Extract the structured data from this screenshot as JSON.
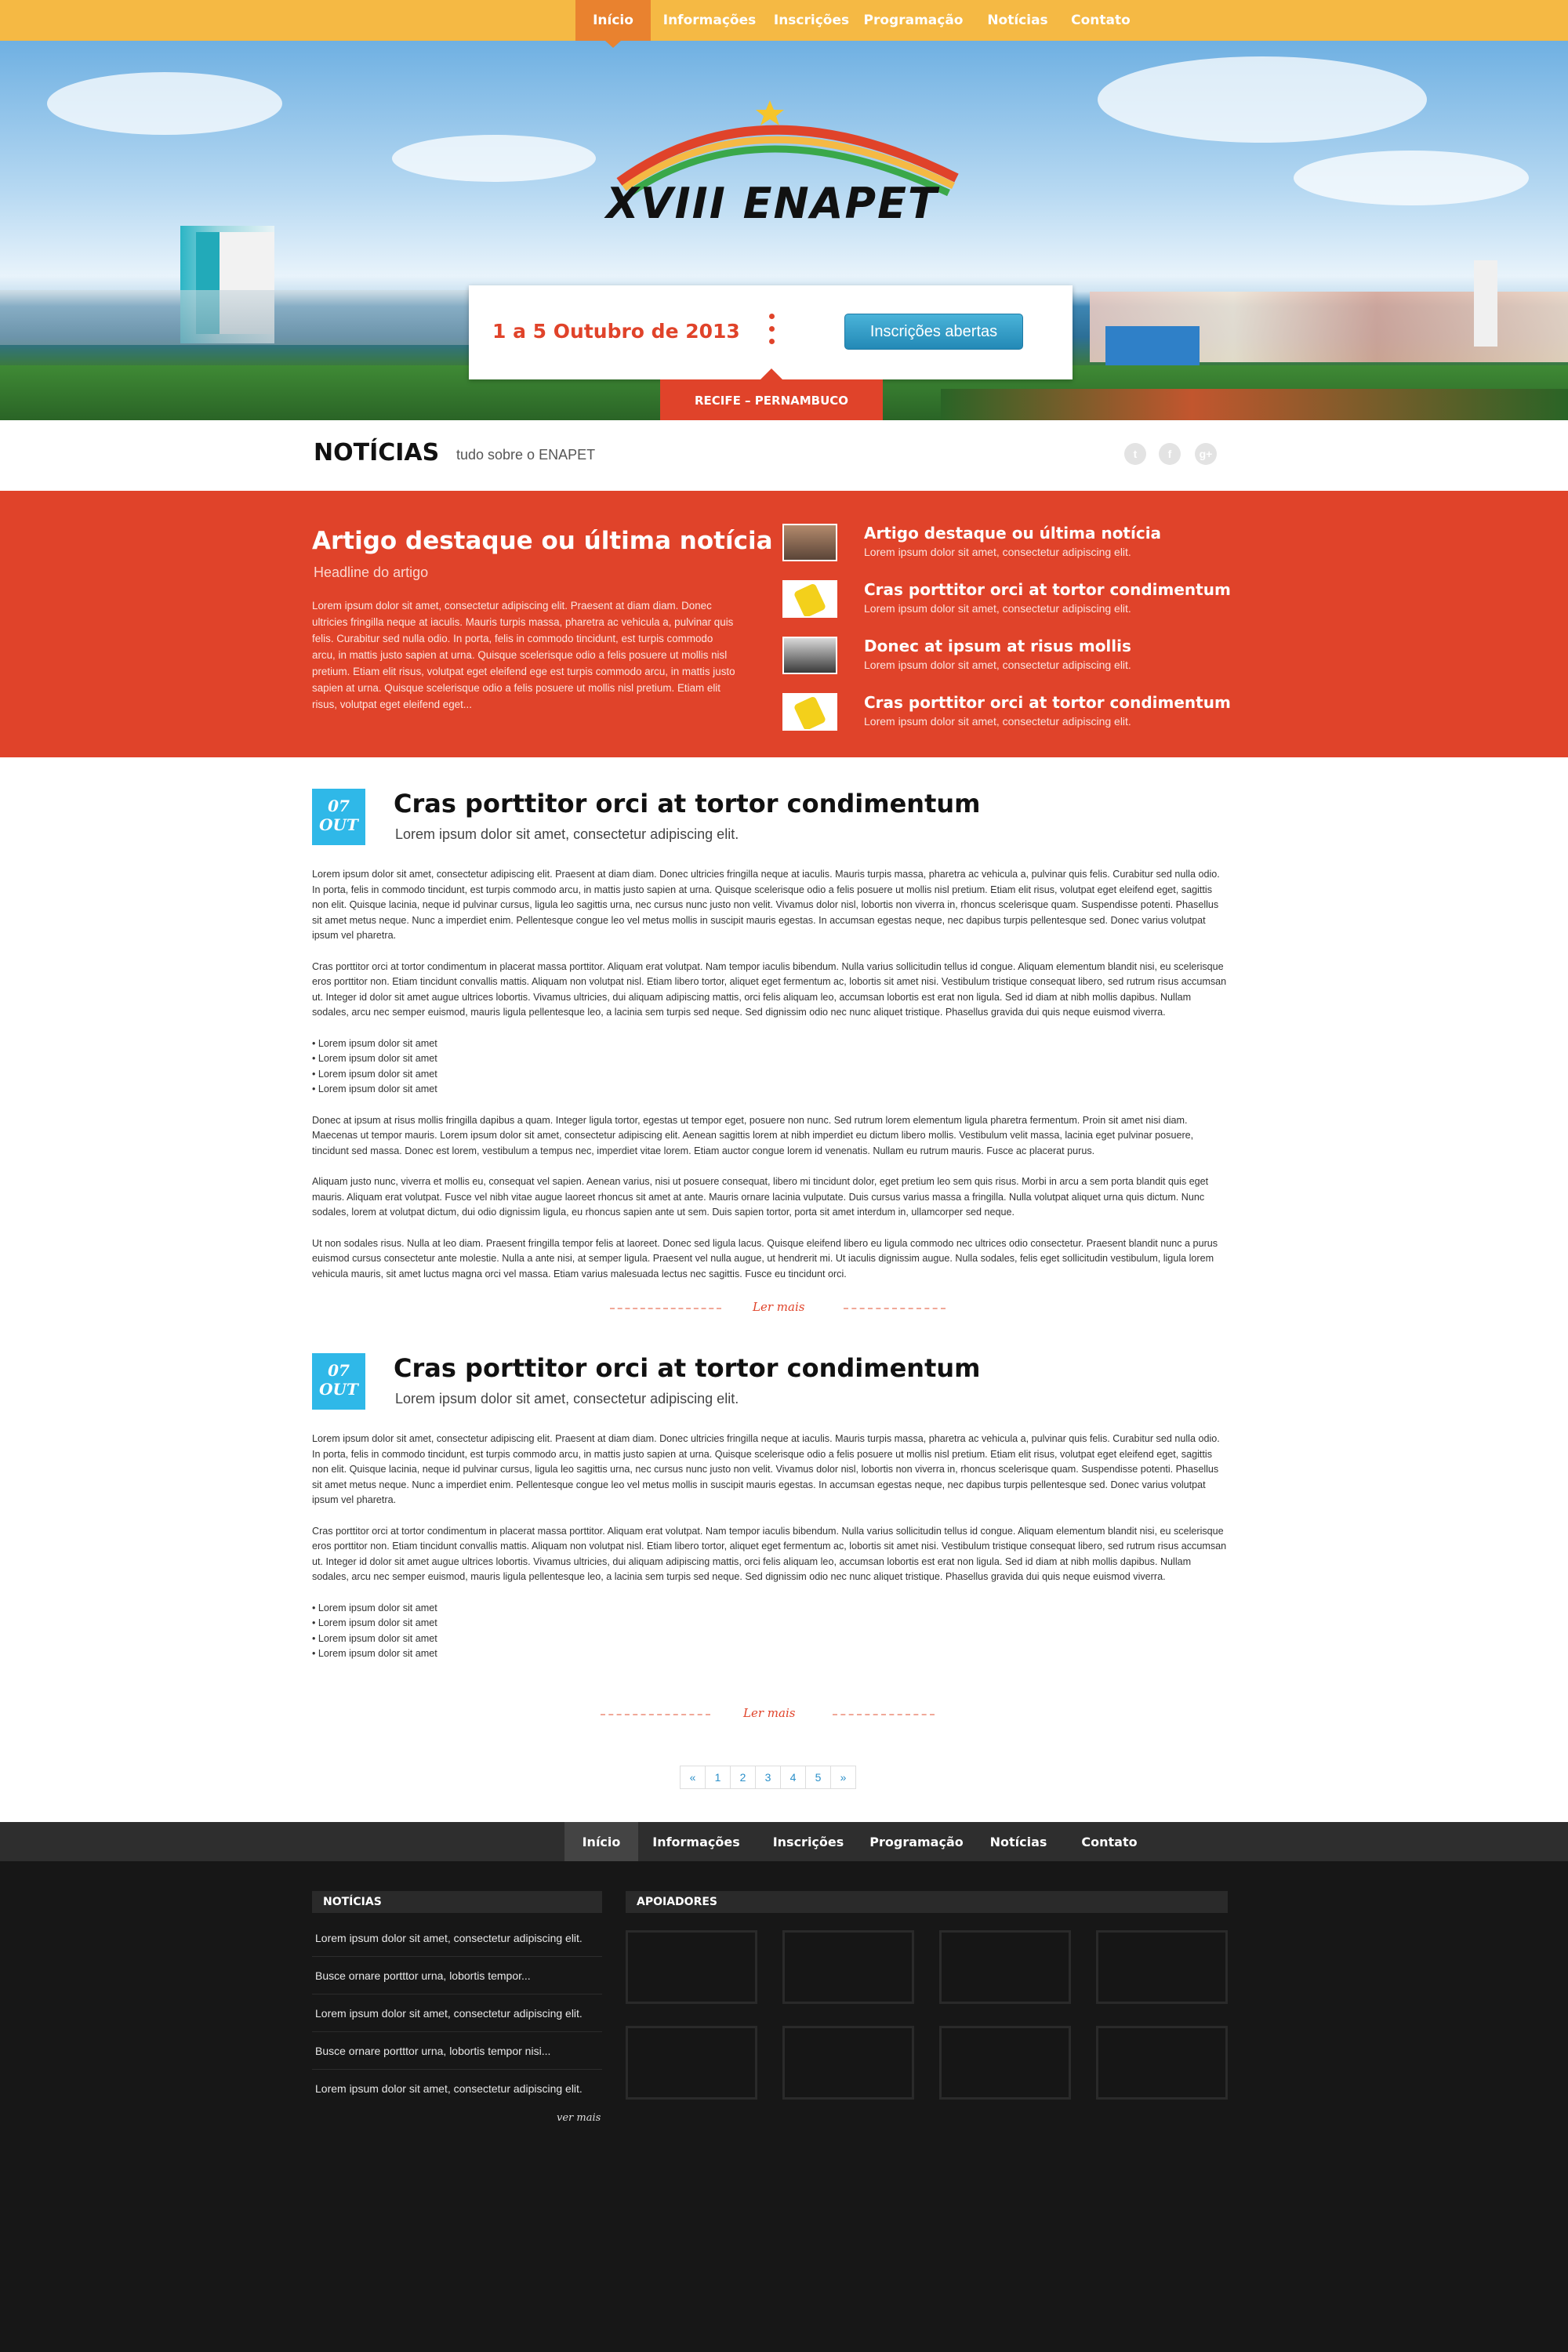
{
  "nav": {
    "items": [
      "Início",
      "Informações",
      "Inscrições",
      "Programação",
      "Notícias",
      "Contato"
    ],
    "active": "Início"
  },
  "hero": {
    "logo_text": "XVIII ENAPET",
    "date": "1 a 5 Outubro de 2013",
    "cta": "Inscrições abertas",
    "location": "RECIFE – PERNAMBUCO"
  },
  "news_header": {
    "title": "NOTÍCIAS",
    "subtitle": "tudo sobre o ENAPET",
    "social_icons": [
      "twitter-icon",
      "facebook-icon",
      "google-plus-icon"
    ]
  },
  "featured": {
    "title": "Artigo destaque ou última notícia",
    "headline": "Headline do artigo",
    "body": "Lorem ipsum dolor sit amet, consectetur adipiscing elit. Praesent at diam diam. Donec ultricies fringilla neque at iaculis. Mauris turpis massa, pharetra ac vehicula a, pulvinar quis felis. Curabitur sed nulla odio. In porta, felis in commodo tincidunt, est turpis commodo arcu, in mattis justo sapien at urna. Quisque scelerisque odio a felis posuere ut mollis nisl pretium. Etiam elit risus, volutpat eget eleifend ege est turpis commodo arcu, in mattis justo sapien at urna. Quisque scelerisque odio a felis posuere ut mollis nisl pretium. Etiam elit risus, volutpat eget eleifend eget...",
    "list": [
      {
        "title": "Artigo destaque ou última notícia",
        "desc": "Lorem ipsum dolor sit amet, consectetur adipiscing elit."
      },
      {
        "title": "Cras porttitor orci at tortor condimentum",
        "desc": "Lorem ipsum dolor sit amet, consectetur adipiscing elit."
      },
      {
        "title": "Donec at ipsum at risus mollis",
        "desc": "Lorem ipsum dolor sit amet, consectetur adipiscing elit."
      },
      {
        "title": "Cras porttitor orci at tortor condimentum",
        "desc": "Lorem ipsum dolor sit amet, consectetur adipiscing elit."
      }
    ]
  },
  "articles": [
    {
      "day": "07",
      "month": "OUT",
      "title": "Cras porttitor orci at tortor condimentum",
      "subtitle": "Lorem ipsum dolor sit amet, consectetur adipiscing elit.",
      "p1": "Lorem ipsum dolor sit amet, consectetur adipiscing elit. Praesent at diam diam. Donec ultricies fringilla neque at iaculis. Mauris turpis massa, pharetra ac vehicula a, pulvinar quis felis. Curabitur sed nulla odio. In porta, felis in commodo tincidunt, est turpis commodo arcu, in mattis justo sapien at urna. Quisque scelerisque odio a felis posuere ut mollis nisl pretium. Etiam elit risus, volutpat eget eleifend eget, sagittis non elit. Quisque lacinia, neque id pulvinar cursus, ligula leo sagittis urna, nec cursus nunc justo non velit. Vivamus dolor nisl, lobortis non viverra in, rhoncus scelerisque quam. Suspendisse potenti. Phasellus sit amet metus neque. Nunc a imperdiet enim. Pellentesque congue leo vel metus mollis in suscipit mauris egestas. In accumsan egestas neque, nec dapibus turpis pellentesque sed. Donec varius volutpat ipsum vel pharetra.",
      "p2": "Cras porttitor orci at tortor condimentum in placerat massa porttitor. Aliquam erat volutpat. Nam tempor iaculis bibendum. Nulla varius sollicitudin tellus id congue. Aliquam elementum blandit nisi, eu scelerisque eros porttitor non. Etiam tincidunt convallis mattis. Aliquam non volutpat nisl. Etiam libero tortor, aliquet eget fermentum ac, lobortis sit amet nisi. Vestibulum tristique consequat libero, sed rutrum risus accumsan ut. Integer id dolor sit amet augue ultrices lobortis. Vivamus ultricies, dui aliquam adipiscing mattis, orci felis aliquam leo, accumsan lobortis est erat non ligula. Sed id diam at nibh mollis dapibus. Nullam sodales, arcu nec semper euismod, mauris ligula pellentesque leo, a lacinia sem turpis sed neque. Sed dignissim odio nec nunc aliquet tristique. Phasellus gravida dui quis neque euismod viverra.",
      "bullets": [
        "• Lorem ipsum dolor sit amet",
        "• Lorem ipsum dolor sit amet",
        "• Lorem ipsum dolor sit amet",
        "• Lorem ipsum dolor sit amet"
      ],
      "p3": "Donec at ipsum at risus mollis fringilla dapibus a quam. Integer ligula tortor, egestas ut tempor eget, posuere non nunc. Sed rutrum lorem elementum ligula pharetra fermentum. Proin sit amet nisi diam. Maecenas ut tempor mauris. Lorem ipsum dolor sit amet, consectetur adipiscing elit. Aenean sagittis lorem at nibh imperdiet eu dictum libero mollis. Vestibulum velit massa, lacinia eget pulvinar posuere, tincidunt sed massa. Donec est lorem, vestibulum a tempus nec, imperdiet vitae lorem. Etiam auctor congue lorem id venenatis. Nullam eu rutrum mauris. Fusce ac placerat purus.",
      "p4": "Aliquam justo nunc, viverra et mollis eu, consequat vel sapien. Aenean varius, nisi ut posuere consequat, libero mi tincidunt dolor, eget pretium leo sem quis risus. Morbi in arcu a sem porta blandit quis eget mauris. Aliquam erat volutpat. Fusce vel nibh vitae augue laoreet rhoncus sit amet at ante. Mauris ornare lacinia vulputate. Duis cursus varius massa a fringilla. Nulla volutpat aliquet urna quis dictum. Nunc sodales, lorem at volutpat dictum, dui odio dignissim ligula, eu rhoncus sapien ante ut sem. Duis sapien tortor, porta sit amet interdum in, ullamcorper sed neque.",
      "p5": "Ut non sodales risus. Nulla at leo diam. Praesent fringilla tempor felis at laoreet. Donec sed ligula lacus. Quisque eleifend libero eu ligula commodo nec ultrices odio consectetur. Praesent blandit nunc a purus euismod cursus consectetur ante molestie. Nulla a ante nisi, at semper ligula. Praesent vel nulla augue, ut hendrerit mi. Ut iaculis dignissim augue. Nulla sodales, felis eget sollicitudin vestibulum, ligula lorem vehicula mauris, sit amet luctus magna orci vel massa. Etiam varius malesuada lectus nec sagittis. Fusce eu tincidunt orci.",
      "read_more": "Ler mais"
    },
    {
      "day": "07",
      "month": "OUT",
      "title": "Cras porttitor orci at tortor condimentum",
      "subtitle": "Lorem ipsum dolor sit amet, consectetur adipiscing elit.",
      "p1": "Lorem ipsum dolor sit amet, consectetur adipiscing elit. Praesent at diam diam. Donec ultricies fringilla neque at iaculis. Mauris turpis massa, pharetra ac vehicula a, pulvinar quis felis. Curabitur sed nulla odio. In porta, felis in commodo tincidunt, est turpis commodo arcu, in mattis justo sapien at urna. Quisque scelerisque odio a felis posuere ut mollis nisl pretium. Etiam elit risus, volutpat eget eleifend eget, sagittis non elit. Quisque lacinia, neque id pulvinar cursus, ligula leo sagittis urna, nec cursus nunc justo non velit. Vivamus dolor nisl, lobortis non viverra in, rhoncus scelerisque quam. Suspendisse potenti. Phasellus sit amet metus neque. Nunc a imperdiet enim. Pellentesque congue leo vel metus mollis in suscipit mauris egestas. In accumsan egestas neque, nec dapibus turpis pellentesque sed. Donec varius volutpat ipsum vel pharetra.",
      "p2": "Cras porttitor orci at tortor condimentum in placerat massa porttitor. Aliquam erat volutpat. Nam tempor iaculis bibendum. Nulla varius sollicitudin tellus id congue. Aliquam elementum blandit nisi, eu scelerisque eros porttitor non. Etiam tincidunt convallis mattis. Aliquam non volutpat nisl. Etiam libero tortor, aliquet eget fermentum ac, lobortis sit amet nisi. Vestibulum tristique consequat libero, sed rutrum risus accumsan ut. Integer id dolor sit amet augue ultrices lobortis. Vivamus ultricies, dui aliquam adipiscing mattis, orci felis aliquam leo, accumsan lobortis est erat non ligula. Sed id diam at nibh mollis dapibus. Nullam sodales, arcu nec semper euismod, mauris ligula pellentesque leo, a lacinia sem turpis sed neque. Sed dignissim odio nec nunc aliquet tristique. Phasellus gravida dui quis neque euismod viverra.",
      "bullets": [
        "• Lorem ipsum dolor sit amet",
        "• Lorem ipsum dolor sit amet",
        "• Lorem ipsum dolor sit amet",
        "• Lorem ipsum dolor sit amet"
      ],
      "read_more": "Ler mais"
    }
  ],
  "pagination": [
    "«",
    "1",
    "2",
    "3",
    "4",
    "5",
    "»"
  ],
  "footer_nav": {
    "items": [
      "Início",
      "Informações",
      "Inscrições",
      "Programação",
      "Notícias",
      "Contato"
    ],
    "active": "Início"
  },
  "footer": {
    "news_title": "NOTÍCIAS",
    "news": [
      "Lorem ipsum dolor sit amet, consectetur adipiscing elit.",
      "Busce ornare portttor urna, lobortis tempor...",
      "Lorem ipsum dolor sit amet, consectetur adipiscing elit.",
      "Busce ornare portttor urna, lobortis tempor nisi...",
      "Lorem ipsum dolor sit amet, consectetur adipiscing elit."
    ],
    "see_more": "ver mais",
    "supporters_title": "APOIADORES"
  },
  "colors": {
    "nav_bg": "#f5b944",
    "nav_active": "#e9822f",
    "accent_red": "#e0432a",
    "badge_blue": "#2fb8e8",
    "button_blue": "#2389b6",
    "footer_bg": "#171717"
  }
}
